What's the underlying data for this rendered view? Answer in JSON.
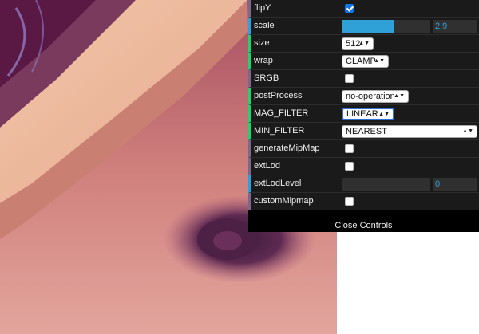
{
  "background": {
    "description_icon": "zoomed-face-texture"
  },
  "gui": {
    "rows": [
      {
        "label": "flipY",
        "type": "checkbox",
        "checked": true
      },
      {
        "label": "scale",
        "type": "slider",
        "value": "2.9",
        "fill_fraction": 0.6
      },
      {
        "label": "size",
        "type": "select",
        "value": "512"
      },
      {
        "label": "wrap",
        "type": "select",
        "value": "CLAMP"
      },
      {
        "label": "SRGB",
        "type": "checkbox",
        "checked": false
      },
      {
        "label": "postProcess",
        "type": "select",
        "value": "no-operation"
      },
      {
        "label": "MAG_FILTER",
        "type": "select",
        "value": "LINEAR",
        "focused": true
      },
      {
        "label": "MIN_FILTER",
        "type": "select",
        "value": "NEAREST"
      },
      {
        "label": "generateMipMap",
        "type": "checkbox",
        "checked": false
      },
      {
        "label": "extLod",
        "type": "checkbox",
        "checked": false
      },
      {
        "label": "extLodLevel",
        "type": "slider",
        "value": "0",
        "fill_fraction": 0
      },
      {
        "label": "customMipmap",
        "type": "checkbox",
        "checked": false
      }
    ],
    "close_label": "Close Controls"
  },
  "colors": {
    "number_accent": "#2fa1d6",
    "select_accent": "#1ed36f",
    "checkbox_accent": "#806787",
    "focus_border": "#2f6fd8"
  }
}
